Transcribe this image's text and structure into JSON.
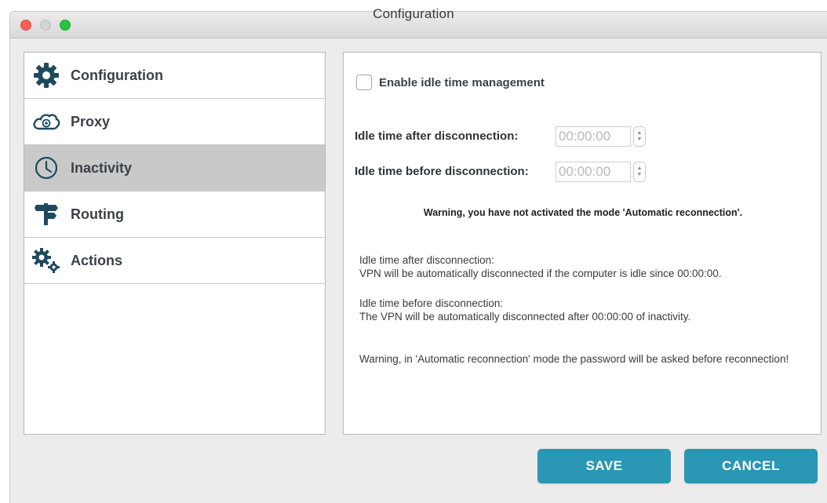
{
  "window": {
    "title": "Configuration"
  },
  "sidebar": {
    "items": [
      {
        "label": "Configuration",
        "icon": "gear-icon",
        "active": false
      },
      {
        "label": "Proxy",
        "icon": "cloud-at-icon",
        "active": false
      },
      {
        "label": "Inactivity",
        "icon": "clock-icon",
        "active": true
      },
      {
        "label": "Routing",
        "icon": "signpost-icon",
        "active": false
      },
      {
        "label": "Actions",
        "icon": "gears-icon",
        "active": false
      }
    ]
  },
  "content": {
    "enable_label": "Enable idle time management",
    "enable_checked": false,
    "after_label": "Idle time after disconnection:",
    "after_value": "00:00:00",
    "before_label": "Idle time before disconnection:",
    "before_value": "00:00:00",
    "warning": "Warning, you have not activated the mode 'Automatic reconnection'.",
    "info_after_title": "Idle time after disconnection:",
    "info_after_text": "VPN will be automatically disconnected if the computer is idle since 00:00:00.",
    "info_before_title": "Idle time before disconnection:",
    "info_before_text": "The VPN will be automatically disconnected after 00:00:00 of inactivity.",
    "info_warning": "Warning, in 'Automatic reconnection' mode the password will be asked before reconnection!"
  },
  "buttons": {
    "save": "SAVE",
    "cancel": "CANCEL"
  },
  "colors": {
    "accent": "#2a97b4",
    "icon": "#1e4a5e",
    "active_row": "#c9c9c9"
  }
}
